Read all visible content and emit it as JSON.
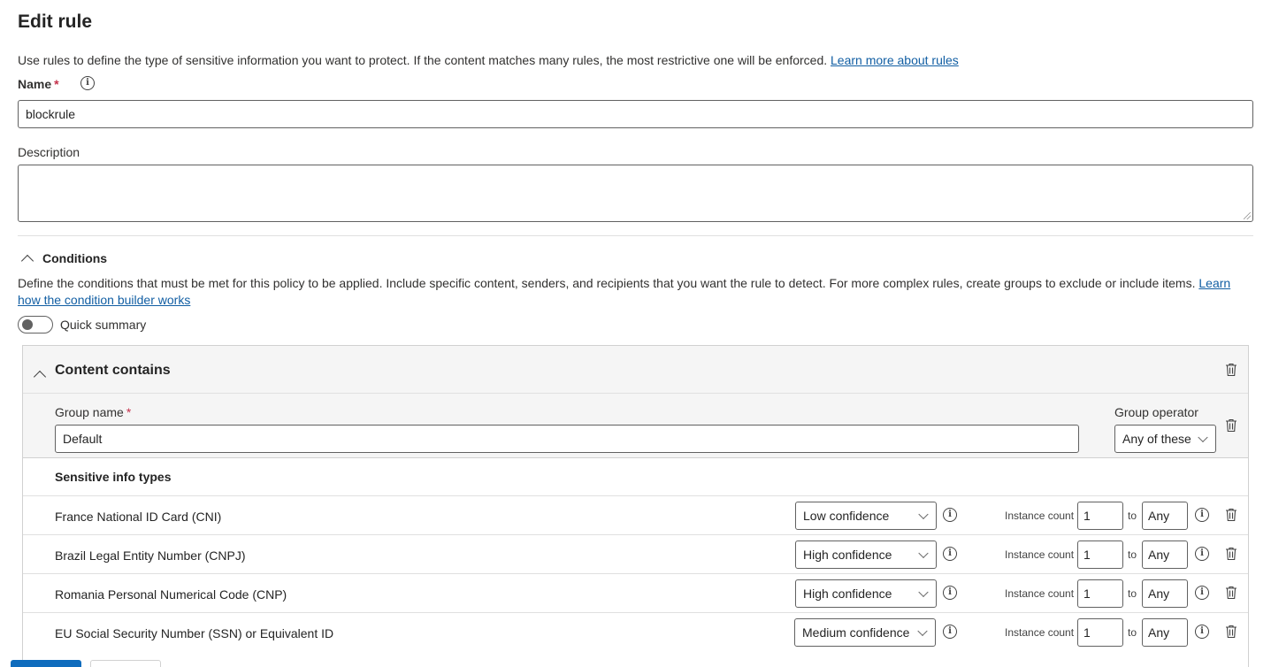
{
  "page": {
    "title": "Edit rule",
    "intro_text": "Use rules to define the type of sensitive information you want to protect. If the content matches many rules, the most restrictive one will be enforced.",
    "intro_link": "Learn more about rules"
  },
  "form": {
    "name_label": "Name",
    "required_mark": "*",
    "name_value": "blockrule",
    "description_label": "Description",
    "description_value": ""
  },
  "conditions": {
    "header": "Conditions",
    "description": "Define the conditions that must be met for this policy to be applied. Include specific content, senders, and recipients that you want the rule to detect. For more complex rules, create groups to exclude or include items.",
    "link": "Learn how the condition builder works",
    "quick_summary_label": "Quick summary",
    "quick_summary_on": false
  },
  "content_contains": {
    "title": "Content contains",
    "group_name_label": "Group name",
    "group_name_value": "Default",
    "group_operator_label": "Group operator",
    "group_operator_value": "Any of these",
    "sensitive_info_types_label": "Sensitive info types",
    "instance_count_label": "Instance count",
    "to_label": "to",
    "rows": [
      {
        "name": "France National ID Card (CNI)",
        "confidence": "Low confidence",
        "min": "1",
        "max": "Any"
      },
      {
        "name": "Brazil Legal Entity Number (CNPJ)",
        "confidence": "High confidence",
        "min": "1",
        "max": "Any"
      },
      {
        "name": "Romania Personal Numerical Code (CNP)",
        "confidence": "High confidence",
        "min": "1",
        "max": "Any"
      },
      {
        "name": "EU Social Security Number (SSN) or Equivalent ID",
        "confidence": "Medium confidence",
        "min": "1",
        "max": "Any"
      }
    ]
  },
  "icons": {
    "info": "i",
    "trash": "trash-icon",
    "chevron": "chevron-up-icon"
  },
  "colors": {
    "link": "#115ea3",
    "primary": "#0f6cbd",
    "required": "#c4314b"
  }
}
